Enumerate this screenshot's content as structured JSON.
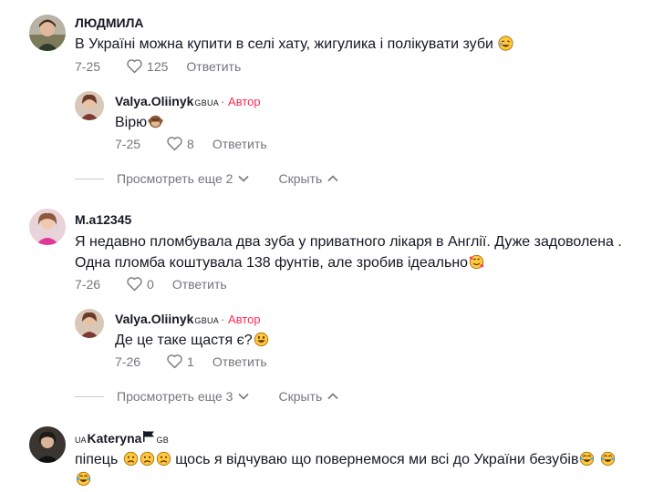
{
  "comments": [
    {
      "user": "ЛЮДМИЛА",
      "text": "В Україні можна купити в селі хату, жигулика і полікувати зуби",
      "date": "7-25",
      "likes": "125",
      "reply_label": "Ответить",
      "replies": [
        {
          "user": "Valya.Oliinyk",
          "user_suffix": "GBUA",
          "author_label": "· Автор",
          "text": "Вірю",
          "date": "7-25",
          "likes": "8",
          "reply_label": "Ответить"
        }
      ],
      "more_label": "Просмотреть еще 2",
      "hide_label": "Скрыть"
    },
    {
      "user": "M.a12345",
      "text_line1": "Я недавно пломбувала два зуба у приватного лікаря в Англії. Дуже задоволена .",
      "text_line2": "Одна пломба коштувала 138 фунтів, але зробив ідеально",
      "date": "7-26",
      "likes": "0",
      "reply_label": "Ответить",
      "replies": [
        {
          "user": "Valya.Oliinyk",
          "user_suffix": "GBUA",
          "author_label": "· Автор",
          "text": "Де це таке щастя є?",
          "date": "7-26",
          "likes": "1",
          "reply_label": "Ответить"
        }
      ],
      "more_label": "Просмотреть еще 3",
      "hide_label": "Скрыть"
    },
    {
      "user_prefix": "UA",
      "user": "Kateryna",
      "user_suffix": "GB",
      "text": "піпець",
      "text_tail": "щось я відчуваю що повернемося ми всі до України безубів"
    }
  ],
  "icons": {
    "like": "heart-outline-icon",
    "expand": "chevron-down-icon",
    "collapse": "chevron-up-icon"
  },
  "colors": {
    "author": "#fe2c55",
    "meta": "#75767c",
    "text": "#161823"
  }
}
